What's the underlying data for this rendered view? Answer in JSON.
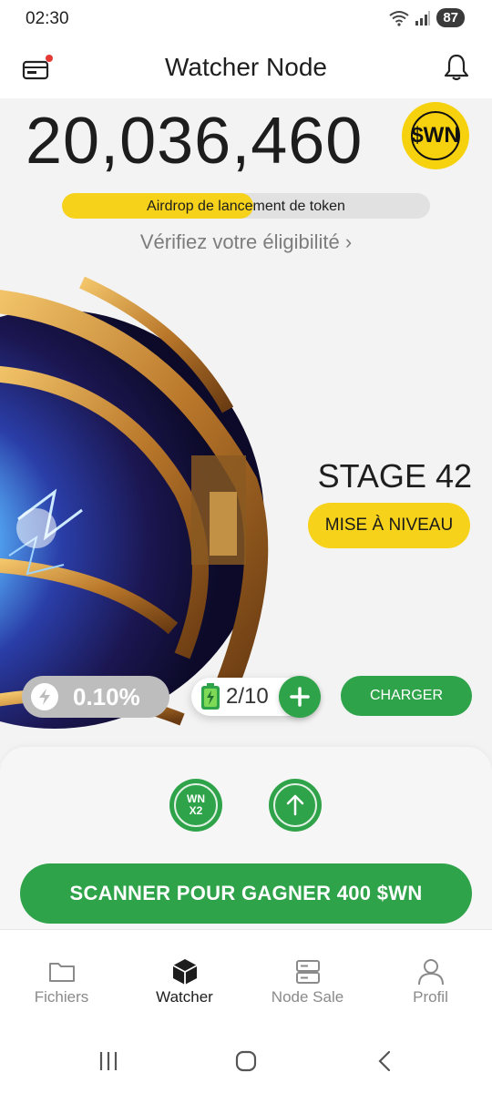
{
  "status": {
    "time": "02:30",
    "battery": "87"
  },
  "header": {
    "title": "Watcher Node"
  },
  "balance": {
    "amount": "20,036,460",
    "token": "$WN"
  },
  "airdrop": {
    "label": "Airdrop de lancement de token",
    "progress": 0.52
  },
  "eligibility": {
    "label": "Vérifiez votre éligibilité ›"
  },
  "stage": {
    "label": "STAGE 42",
    "upgrade_label": "MISE À NIVEAU"
  },
  "mining": {
    "rate": "0.10%",
    "energy": "2/10",
    "charge_label": "CHARGER"
  },
  "actions": {
    "boost_line1": "WN",
    "boost_line2": "X2",
    "scan_label": "SCANNER POUR GAGNER 400 $WN"
  },
  "tabs": [
    {
      "label": "Fichiers",
      "icon": "folder-icon",
      "active": false
    },
    {
      "label": "Watcher",
      "icon": "cube-icon",
      "active": true
    },
    {
      "label": "Node Sale",
      "icon": "server-icon",
      "active": false
    },
    {
      "label": "Profil",
      "icon": "user-icon",
      "active": false
    }
  ],
  "colors": {
    "accent_green": "#2fa34a",
    "accent_yellow": "#f7d21a",
    "pill_gray": "#bdbdbd"
  }
}
